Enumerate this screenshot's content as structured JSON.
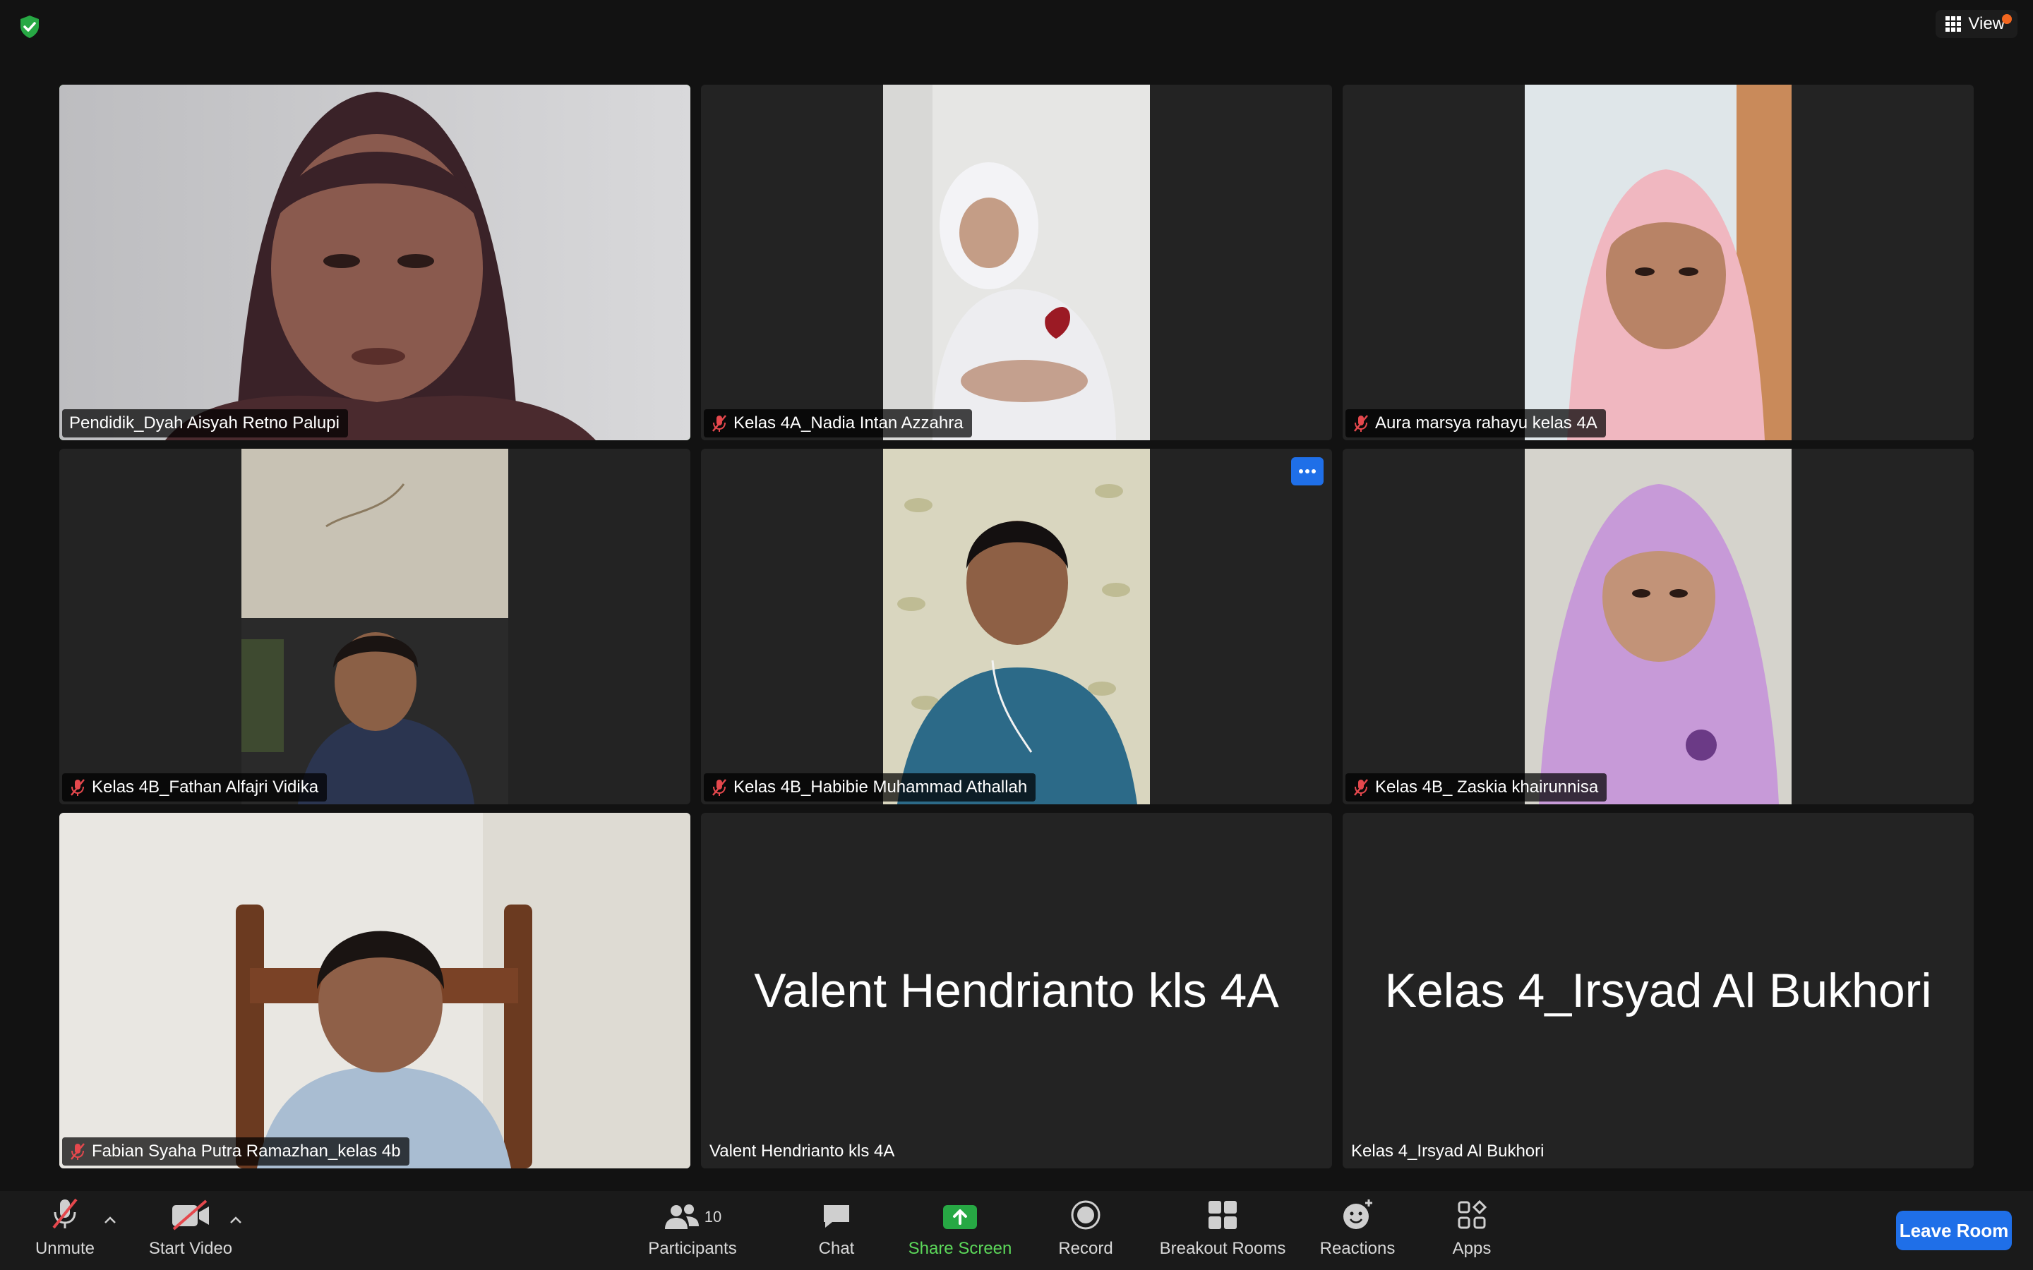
{
  "top_bar": {
    "security_icon": "shield-check-icon",
    "view_label": "View"
  },
  "participants": [
    {
      "name": "Pendidik_Dyah Aisyah Retno Palupi",
      "muted": false,
      "video": "full",
      "active": true,
      "scene": "woman-hijab"
    },
    {
      "name": "Kelas 4A_Nadia Intan Azzahra",
      "muted": true,
      "video": "portrait",
      "scene": "girl-white-hijab"
    },
    {
      "name": "Aura marsya rahayu kelas 4A",
      "muted": true,
      "video": "portrait",
      "scene": "girl-pink-hijab"
    },
    {
      "name": "Kelas 4B_Fathan Alfajri Vidika",
      "muted": true,
      "video": "portrait",
      "scene": "boy-ceiling"
    },
    {
      "name": "Kelas 4B_Habibie Muhammad Athallah",
      "muted": true,
      "video": "portrait",
      "scene": "boy-leaves",
      "more_button": true
    },
    {
      "name": "Kelas 4B_ Zaskia khairunnisa",
      "muted": true,
      "video": "portrait",
      "scene": "girl-purple-hijab"
    },
    {
      "name": "Fabian Syaha Putra Ramazhan_kelas 4b",
      "muted": true,
      "video": "full",
      "scene": "boy-chair"
    },
    {
      "name": "Valent Hendrianto kls 4A",
      "muted": false,
      "video": "none",
      "big_name": "Valent Hendrianto kls 4A"
    },
    {
      "name": "Kelas 4_Irsyad Al Bukhori",
      "muted": false,
      "video": "none",
      "big_name": "Kelas 4_Irsyad Al Bukhori"
    }
  ],
  "toolbar": {
    "unmute": "Unmute",
    "start_video": "Start Video",
    "participants": "Participants",
    "participants_count": "10",
    "chat": "Chat",
    "share_screen": "Share Screen",
    "record": "Record",
    "breakout_rooms": "Breakout Rooms",
    "reactions": "Reactions",
    "apps": "Apps",
    "leave": "Leave Room"
  },
  "colors": {
    "active_speaker": "#5cd85a",
    "share_green": "#5cd85a",
    "leave_blue": "#1f6fe8",
    "mute_red": "#e5484d"
  }
}
